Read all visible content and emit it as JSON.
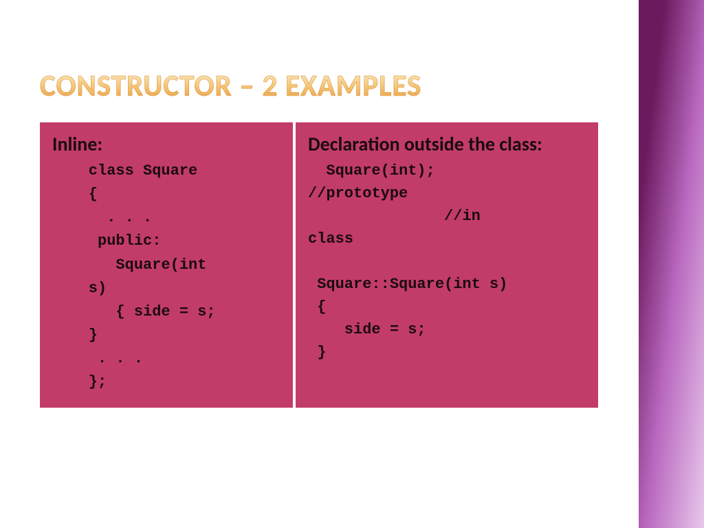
{
  "title": "CONSTRUCTOR – 2 EXAMPLES",
  "left": {
    "heading": "Inline:",
    "code": "    class Square\n    {\n      . . .\n     public:\n       Square(int\n    s)\n       { side = s;\n    }\n     . . .\n    };"
  },
  "right": {
    "heading": "Declaration outside the class:",
    "code": "  Square(int);\n//prototype\n               //in\nclass\n\n Square::Square(int s)\n {\n    side = s;\n }"
  }
}
